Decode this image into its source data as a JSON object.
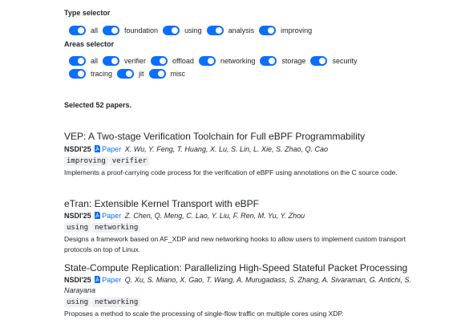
{
  "filters": {
    "type": {
      "title": "Type selector",
      "options": [
        "all",
        "foundation",
        "using",
        "analysis",
        "improving"
      ]
    },
    "areas": {
      "title": "Areas selector",
      "options": [
        "all",
        "verifier",
        "offload",
        "networking",
        "storage",
        "security",
        "tracing",
        "jit",
        "misc"
      ]
    },
    "accent_color": "#0d6efd"
  },
  "selected_text": "Selected 52 papers.",
  "papers": [
    {
      "title": "VEP: A Two-stage Verification Toolchain for Full eBPF Programmability",
      "venue": "NSDI'25",
      "link_label": "Paper",
      "authors": "X. Wu, Y. Feng, T. Huang, X. Lu, S. Lin, L. Xie, S. Zhao, Q. Cao",
      "tags": [
        "improving",
        "verifier"
      ],
      "summary": "Implements a proof-carrying code process for the verification of eBPF using annotations on the C source code."
    },
    {
      "title": "eTran: Extensible Kernel Transport with eBPF",
      "venue": "NSDI'25",
      "link_label": "Paper",
      "authors": "Z. Chen, Q. Meng, C. Lao, Y. Liu, F. Ren, M. Yu, Y. Zhou",
      "tags": [
        "using",
        "networking"
      ],
      "summary": "Designs a framework based on AF_XDP and new networking hooks to allow users to implement custom transport protocols on top of Linux."
    },
    {
      "title": "State-Compute Replication: Parallelizing High-Speed Stateful Packet Processing",
      "venue": "NSDI'25",
      "link_label": "Paper",
      "authors": "Q. Xu, S. Miano, X. Gao, T. Wang, A. Murugadass, S. Zhang, A. Sivaraman, G. Antichi, S. Narayana",
      "tags": [
        "using",
        "networking"
      ],
      "summary": "Proposes a method to scale the processing of single-flow traffic on multiple cores using XDP."
    }
  ]
}
